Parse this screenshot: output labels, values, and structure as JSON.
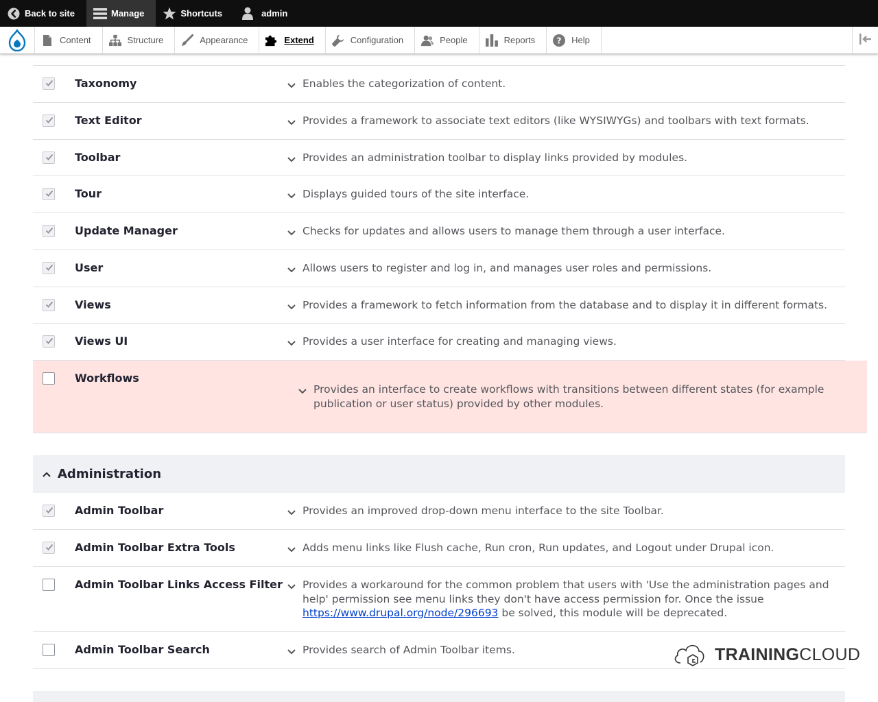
{
  "toolbar": {
    "back_label": "Back to site",
    "manage_label": "Manage",
    "shortcuts_label": "Shortcuts",
    "user_label": "admin"
  },
  "tray": {
    "items": [
      {
        "label": "Content",
        "icon": "file-icon"
      },
      {
        "label": "Structure",
        "icon": "structure-icon"
      },
      {
        "label": "Appearance",
        "icon": "paintbrush-icon"
      },
      {
        "label": "Extend",
        "icon": "puzzle-icon",
        "active": true
      },
      {
        "label": "Configuration",
        "icon": "wrench-icon"
      },
      {
        "label": "People",
        "icon": "people-icon"
      },
      {
        "label": "Reports",
        "icon": "bar-chart-icon"
      },
      {
        "label": "Help",
        "icon": "help-icon"
      }
    ]
  },
  "modules": [
    {
      "name": "Taxonomy",
      "checked": true,
      "description": "Enables the categorization of content."
    },
    {
      "name": "Text Editor",
      "checked": true,
      "description": "Provides a framework to associate text editors (like WYSIWYGs) and toolbars with text formats."
    },
    {
      "name": "Toolbar",
      "checked": true,
      "description": "Provides an administration toolbar to display links provided by modules."
    },
    {
      "name": "Tour",
      "checked": true,
      "description": "Displays guided tours of the site interface."
    },
    {
      "name": "Update Manager",
      "checked": true,
      "description": "Checks for updates and allows users to manage them through a user interface."
    },
    {
      "name": "User",
      "checked": true,
      "description": "Allows users to register and log in, and manages user roles and permissions."
    },
    {
      "name": "Views",
      "checked": true,
      "description": "Provides a framework to fetch information from the database and to display it in different formats."
    },
    {
      "name": "Views UI",
      "checked": true,
      "description": "Provides a user interface for creating and managing views."
    },
    {
      "name": "Workflows",
      "checked": false,
      "highlighted": true,
      "description": "Provides an interface to create workflows with transitions between different states (for example publication or user status) provided by other modules."
    }
  ],
  "administration": {
    "title": "Administration",
    "modules": [
      {
        "name": "Admin Toolbar",
        "checked": true,
        "description": "Provides an improved drop-down menu interface to the site Toolbar."
      },
      {
        "name": "Admin Toolbar Extra Tools",
        "checked": true,
        "description": "Adds menu links like Flush cache, Run cron, Run updates, and Logout under Drupal icon."
      },
      {
        "name": "Admin Toolbar Links Access Filter",
        "checked": false,
        "description_before": "Provides a workaround for the common problem that users with 'Use the administration pages and help' permission see menu links they don't have access permission for. Once the issue",
        "description_link": "https://www.drupal.org/node/296693",
        "description_after": "be solved, this module will be deprecated."
      },
      {
        "name": "Admin Toolbar Search",
        "checked": false,
        "description": "Provides search of Admin Toolbar items."
      }
    ]
  },
  "watermark": {
    "bold": "TRAINING",
    "light": "CLOUD"
  },
  "colors": {
    "accent": "#003ecc",
    "highlight": "#ffe4e2",
    "toolbar": "#0f0f0f",
    "drupal_blue": "#0678be"
  }
}
